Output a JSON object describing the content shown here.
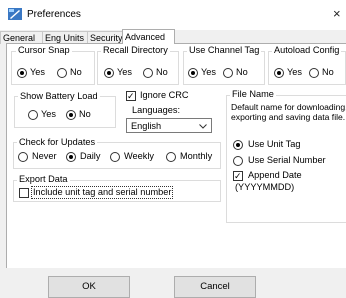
{
  "window": {
    "title": "Preferences",
    "close_glyph": "×"
  },
  "tabs": [
    "General",
    "Eng Units",
    "Security",
    "Advanced"
  ],
  "active_tab": "Advanced",
  "groups": {
    "cursor_snap": {
      "label": "Cursor Snap",
      "yes": "Yes",
      "no": "No",
      "selected": "Yes"
    },
    "recall_directory": {
      "label": "Recall Directory",
      "yes": "Yes",
      "no": "No",
      "selected": "Yes"
    },
    "use_channel_tag": {
      "label": "Use Channel Tag",
      "yes": "Yes",
      "no": "No",
      "selected": "Yes"
    },
    "autoload_config": {
      "label": "Autoload Config",
      "yes": "Yes",
      "no": "No",
      "selected": "Yes"
    },
    "show_battery_load": {
      "label": "Show Battery Load",
      "yes": "Yes",
      "no": "No",
      "selected": "No"
    },
    "check_for_updates": {
      "label": "Check for Updates",
      "never": "Never",
      "daily": "Daily",
      "weekly": "Weekly",
      "monthly": "Monthly",
      "selected": "Daily"
    },
    "export_data": {
      "label": "Export Data",
      "include_label": "Include unit tag and serial number",
      "checked": false
    },
    "file_name": {
      "label": "File Name",
      "desc1": "Default name for downloading,",
      "desc2": "exporting and saving data file.",
      "use_unit_tag": "Use Unit Tag",
      "use_serial": "Use Serial Number",
      "selected": "Use Unit Tag",
      "append_date": "Append Date",
      "append_date_checked": true,
      "date_format": "(YYYYMMDD)"
    }
  },
  "ignore_crc": {
    "label": "Ignore CRC",
    "checked": true
  },
  "languages": {
    "label": "Languages:",
    "value": "English"
  },
  "buttons": {
    "ok": "OK",
    "cancel": "Cancel"
  }
}
